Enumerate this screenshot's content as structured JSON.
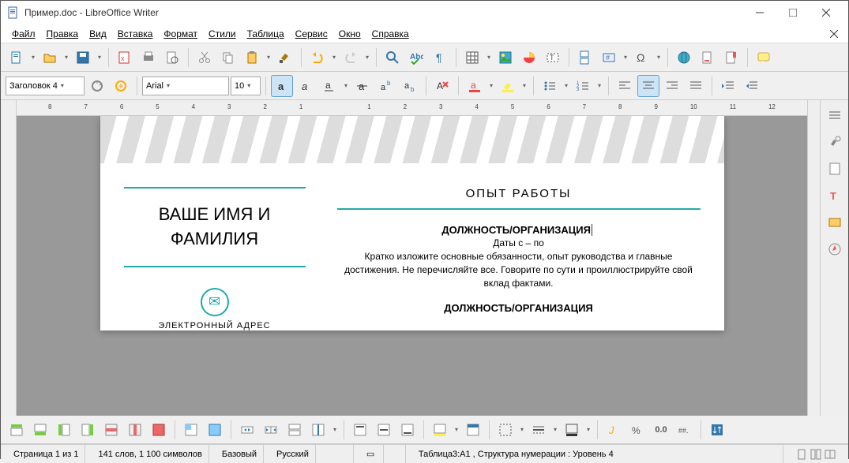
{
  "window": {
    "title": "Пример.doc - LibreOffice Writer"
  },
  "menu": {
    "items": [
      "Файл",
      "Правка",
      "Вид",
      "Вставка",
      "Формат",
      "Стили",
      "Таблица",
      "Сервис",
      "Окно",
      "Справка"
    ]
  },
  "format": {
    "paragraph_style": "Заголовок 4",
    "font_name": "Arial",
    "font_size": "10"
  },
  "doc": {
    "name": "ВАШЕ ИМЯ И ФАМИЛИЯ",
    "email_label": "ЭЛЕКТРОННЫЙ АДРЕС",
    "experience_title": "ОПЫТ РАБОТЫ",
    "job1_title": "ДОЛЖНОСТЬ/ОРГАНИЗАЦИЯ",
    "job1_dates": "Даты с – по",
    "job1_desc": "Кратко изложите основные обязанности, опыт руководства и главные достижения. Не перечисляйте все. Говорите по сути и проиллюстрируйте свой вклад фактами.",
    "job2_title": "ДОЛЖНОСТЬ/ОРГАНИЗАЦИЯ"
  },
  "status": {
    "page": "Страница 1 из 1",
    "words": "141 слов, 1 100 символов",
    "style": "Базовый",
    "lang": "Русский",
    "table": "Таблица3:A1 , Структура нумерации : Уровень 4",
    "zoom_val": "0.0"
  },
  "ruler": {
    "marks": [
      "8",
      "7",
      "6",
      "5",
      "4",
      "3",
      "2",
      "1",
      "",
      "1",
      "2",
      "3",
      "4",
      "5",
      "6",
      "7",
      "8",
      "9",
      "10",
      "11",
      "12"
    ]
  }
}
